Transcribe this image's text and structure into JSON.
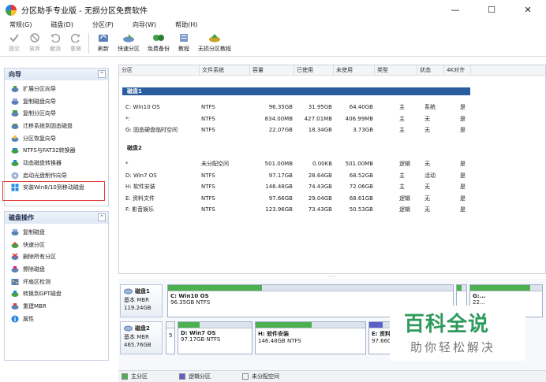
{
  "window": {
    "title": "分区助手专业版 - 无损分区免费软件",
    "controls": [
      "—",
      "☐",
      "✕"
    ]
  },
  "menu": [
    "常规(G)",
    "磁盘(D)",
    "分区(P)",
    "向导(W)",
    "帮助(H)"
  ],
  "toolbar": {
    "commit": "提交",
    "discard": "放弃",
    "undo": "撤消",
    "redo": "重做",
    "refresh": "刷新",
    "quick_partition": "快速分区",
    "free_backup": "免费备份",
    "tutorial": "教程",
    "lossless_tutorial": "无损分区教程"
  },
  "wizard": {
    "title": "向导",
    "items": [
      "扩展分区向导",
      "复制磁盘向导",
      "复制分区向导",
      "迁移系统到固态磁盘",
      "分区恢复向导",
      "NTFS与FAT32转换器",
      "动态磁盘转换器",
      "启动光盘制作向导",
      "安装Win8/10到移动磁盘"
    ]
  },
  "disk_ops": {
    "title": "磁盘操作",
    "items": [
      "复制磁盘",
      "快速分区",
      "删除所有分区",
      "擦除磁盘",
      "坏扇区检测",
      "转换到GPT磁盘",
      "重建MBR",
      "属性"
    ]
  },
  "table": {
    "headers": [
      "分区",
      "文件系统",
      "容量",
      "已使用",
      "未使用",
      "类型",
      "状态",
      "4K对齐"
    ],
    "disk1_label": "磁盘1",
    "disk2_label": "磁盘2",
    "disk1_rows": [
      {
        "name": "C: Win10 OS",
        "fs": "NTFS",
        "cap": "96.35GB",
        "used": "31.95GB",
        "free": "64.40GB",
        "type": "主",
        "status": "系统",
        "align": "是"
      },
      {
        "name": "*:",
        "fs": "NTFS",
        "cap": "834.00MB",
        "used": "427.01MB",
        "free": "406.99MB",
        "type": "主",
        "status": "无",
        "align": "是"
      },
      {
        "name": "G: 固态硬盘临时空间",
        "fs": "NTFS",
        "cap": "22.07GB",
        "used": "18.34GB",
        "free": "3.73GB",
        "type": "主",
        "status": "无",
        "align": "是"
      }
    ],
    "disk2_rows": [
      {
        "name": "*",
        "fs": "未分配空间",
        "cap": "501.00MB",
        "used": "0.00KB",
        "free": "501.00MB",
        "type": "逻辑",
        "status": "无",
        "align": "是"
      },
      {
        "name": "D: Win7 OS",
        "fs": "NTFS",
        "cap": "97.17GB",
        "used": "28.64GB",
        "free": "68.52GB",
        "type": "主",
        "status": "活动",
        "align": "是"
      },
      {
        "name": "H: 软件安装",
        "fs": "NTFS",
        "cap": "146.48GB",
        "used": "74.43GB",
        "free": "72.06GB",
        "type": "主",
        "status": "无",
        "align": "是"
      },
      {
        "name": "E: 资料文件",
        "fs": "NTFS",
        "cap": "97.66GB",
        "used": "29.04GB",
        "free": "68.61GB",
        "type": "逻辑",
        "status": "无",
        "align": "是"
      },
      {
        "name": "F: 影音娱乐",
        "fs": "NTFS",
        "cap": "123.96GB",
        "used": "73.43GB",
        "free": "50.53GB",
        "type": "逻辑",
        "status": "无",
        "align": "是"
      }
    ]
  },
  "diskmap": {
    "disk1": {
      "name": "磁盘1",
      "type": "基本 MBR",
      "size": "119.24GB"
    },
    "disk2": {
      "name": "磁盘2",
      "type": "基本 MBR",
      "size": "465.76GB"
    },
    "d1_parts": [
      {
        "name": "C: Win10 OS",
        "size": "96.35GB NTFS",
        "used": 0.33
      },
      {
        "name": "",
        "size": "",
        "used": 0.51
      },
      {
        "name": "G:...",
        "size": "22...",
        "used": 0.83
      }
    ],
    "d2_parts": [
      {
        "name": "",
        "size": "5",
        "used": 0.0
      },
      {
        "name": "D: Win7 OS",
        "size": "97.17GB NTFS",
        "used": 0.29
      },
      {
        "name": "H: 软件安装",
        "size": "146.48GB NTFS",
        "used": 0.51
      },
      {
        "name": "E: 资料",
        "size": "97.66G",
        "used": 0.3
      }
    ]
  },
  "legend": [
    "主分区",
    "逻辑分区",
    "未分配空间"
  ],
  "watermark": {
    "main": "百科全说",
    "sub": "助你轻松解决"
  },
  "colors": {
    "primary": "#4caf50",
    "logical": "#5b5fc7",
    "disk_bar": "#2a5d9f",
    "highlight": "#e53935"
  }
}
